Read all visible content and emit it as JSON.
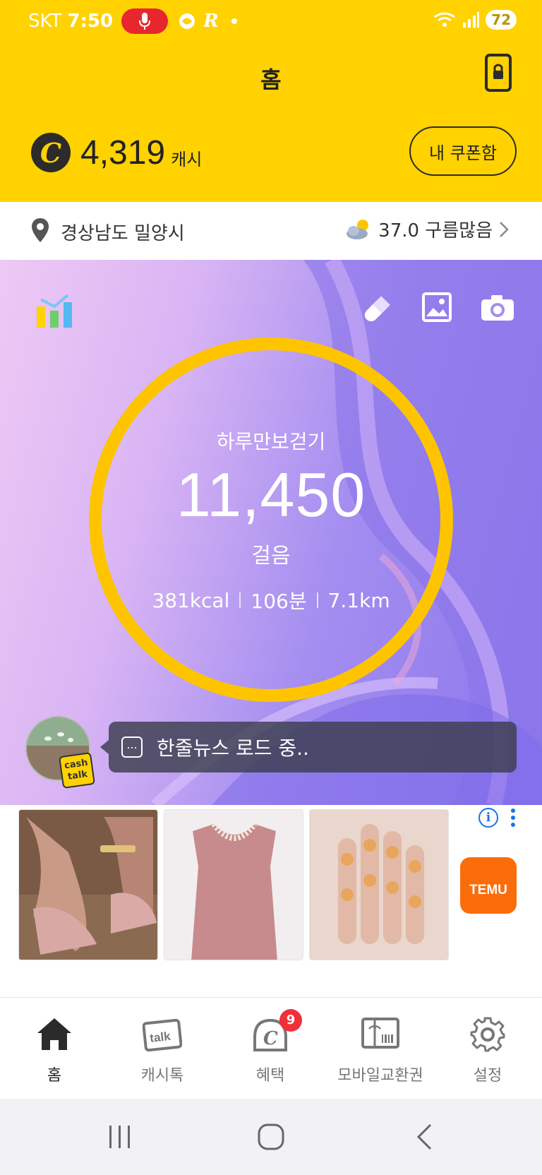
{
  "status_bar": {
    "carrier": "SKT",
    "time": "7:50",
    "battery": "72"
  },
  "header": {
    "title": "홈",
    "cash_value": "4,319",
    "cash_unit": "캐시",
    "coupon_button": "내 쿠폰함"
  },
  "location": {
    "region": "경상남도 밀양시",
    "weather": "37.0 구름많음"
  },
  "hero": {
    "label": "하루만보걷기",
    "steps": "11,450",
    "unit": "걸음",
    "kcal": "381kcal",
    "minutes": "106분",
    "distance": "7.1km",
    "ring_progress": 1.0
  },
  "news": {
    "icon_text": "...",
    "text": "한줄뉴스 로드 중.."
  },
  "cash_talk_badge": {
    "line1": "cash",
    "line2": "talk"
  },
  "ad": {
    "brand_text": "TEMU",
    "images": [
      "sandals",
      "pink-knit-top",
      "bear-nail-charms"
    ]
  },
  "bottom_nav": {
    "items": [
      {
        "label": "홈",
        "icon": "home-icon"
      },
      {
        "label": "캐시톡",
        "icon": "talk-icon"
      },
      {
        "label": "혜택",
        "icon": "benefit-coin-icon",
        "badge": "9"
      },
      {
        "label": "모바일교환권",
        "icon": "gift-voucher-icon"
      },
      {
        "label": "설정",
        "icon": "gear-icon"
      }
    ]
  },
  "colors": {
    "brand_yellow": "#FFD200",
    "ring": "#FFC400",
    "badge_red": "#F0303A",
    "temu_orange": "#FB6D0A"
  }
}
